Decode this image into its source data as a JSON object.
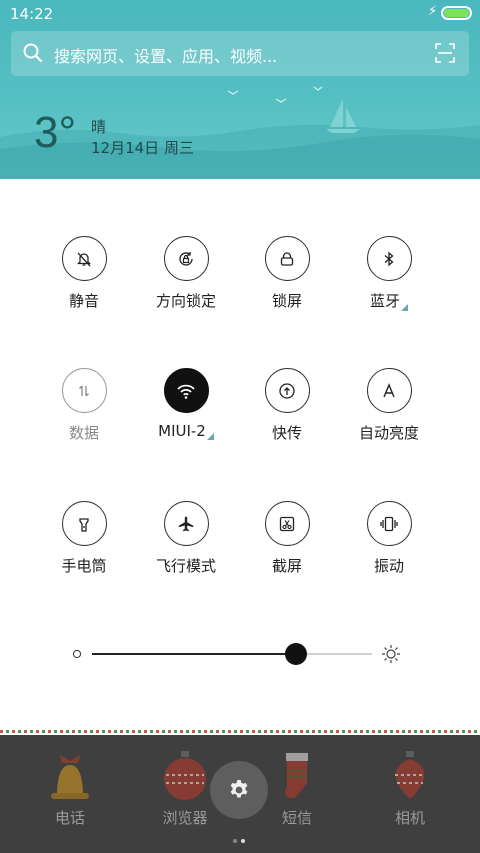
{
  "status": {
    "time": "14:22"
  },
  "search": {
    "placeholder": "搜索网页、设置、应用、视频..."
  },
  "weather": {
    "temperature": "3°",
    "condition": "晴",
    "date": "12月14日 周三"
  },
  "toggles": [
    {
      "label": "静音",
      "icon": "bell-off-icon",
      "state": "off"
    },
    {
      "label": "方向锁定",
      "icon": "rotation-lock-icon",
      "state": "off"
    },
    {
      "label": "锁屏",
      "icon": "lock-icon",
      "state": "off"
    },
    {
      "label": "蓝牙",
      "icon": "bluetooth-icon",
      "state": "off",
      "has_more": true
    },
    {
      "label": "数据",
      "icon": "data-arrows-icon",
      "state": "disabled"
    },
    {
      "label": "MIUI-2",
      "icon": "wifi-icon",
      "state": "on",
      "has_more": true
    },
    {
      "label": "快传",
      "icon": "quick-transfer-icon",
      "state": "off"
    },
    {
      "label": "自动亮度",
      "icon": "auto-brightness-icon",
      "state": "off"
    },
    {
      "label": "手电筒",
      "icon": "flashlight-icon",
      "state": "off"
    },
    {
      "label": "飞行模式",
      "icon": "airplane-icon",
      "state": "off"
    },
    {
      "label": "截屏",
      "icon": "screenshot-icon",
      "state": "off"
    },
    {
      "label": "振动",
      "icon": "vibrate-icon",
      "state": "off"
    }
  ],
  "brightness": {
    "level": 0.73
  },
  "dock": {
    "apps": [
      {
        "label": "电话",
        "icon": "bell-ornament-icon"
      },
      {
        "label": "浏览器",
        "icon": "ornament-icon"
      },
      {
        "label": "短信",
        "icon": "stocking-icon"
      },
      {
        "label": "相机",
        "icon": "ornament-icon"
      }
    ],
    "settings_icon": "gear-icon",
    "pages": 2,
    "current_page": 2
  },
  "colors": {
    "header": "#56c0c3",
    "wifi_on": "#111111",
    "battery": "#7ee35a",
    "dock": "#3f3f3f"
  }
}
